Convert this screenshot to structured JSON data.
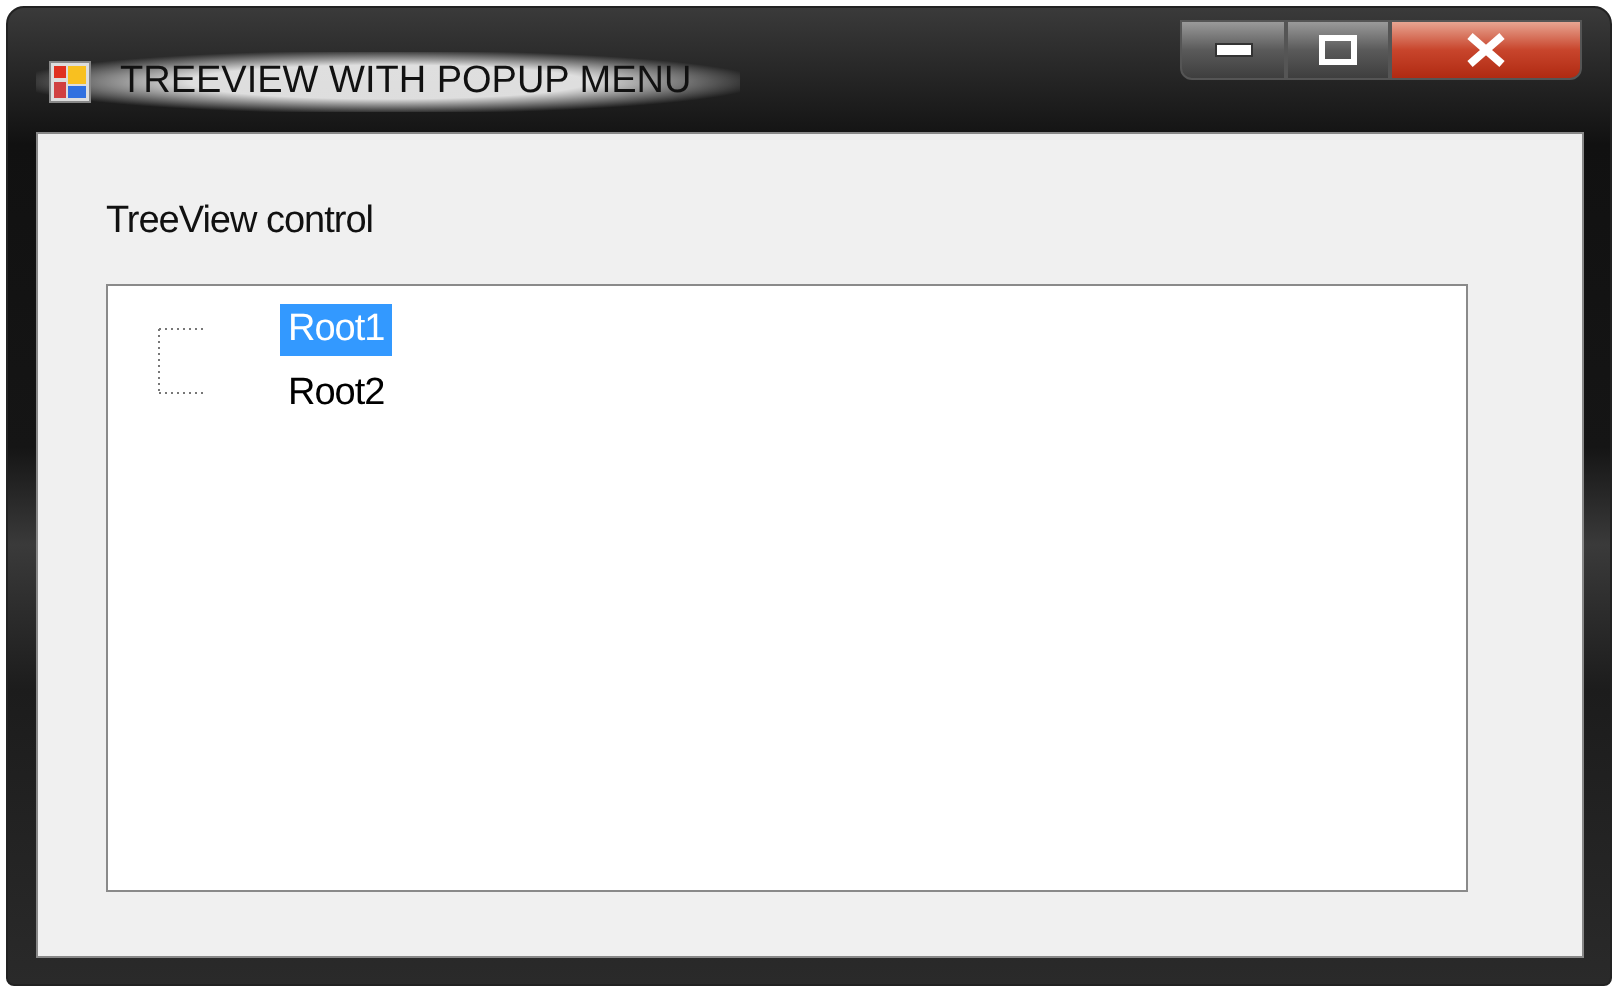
{
  "window": {
    "title": "TREEVIEW WITH POPUP MENU"
  },
  "label": "TreeView control",
  "tree": {
    "nodes": [
      {
        "label": "Root1",
        "selected": true
      },
      {
        "label": "Root2",
        "selected": false
      }
    ]
  }
}
